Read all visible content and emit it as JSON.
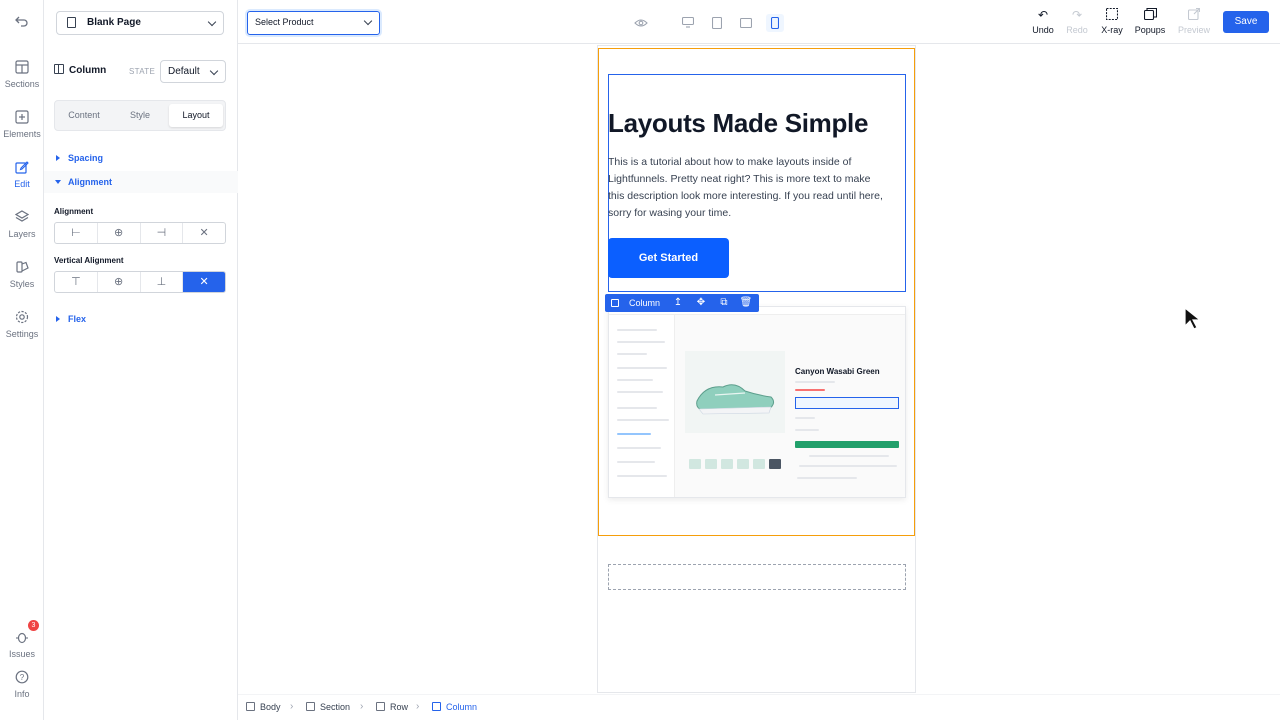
{
  "rail": {
    "back_icon": "undo-arrow-icon",
    "items": [
      {
        "label": "Sections",
        "icon": "sections-icon"
      },
      {
        "label": "Elements",
        "icon": "plus-square-icon"
      },
      {
        "label": "Edit",
        "icon": "pencil-icon"
      },
      {
        "label": "Layers",
        "icon": "layers-icon"
      },
      {
        "label": "Styles",
        "icon": "palette-icon"
      },
      {
        "label": "Settings",
        "icon": "gear-icon"
      }
    ],
    "issues": {
      "label": "Issues",
      "count": "3"
    },
    "info": {
      "label": "Info"
    }
  },
  "panel": {
    "page_select": "Blank Page",
    "element_title": "Column",
    "state_label": "STATE",
    "state_value": "Default",
    "tabs": [
      "Content",
      "Style",
      "Layout"
    ],
    "active_tab": "Layout",
    "sections": {
      "spacing": "Spacing",
      "alignment": "Alignment",
      "flex": "Flex"
    },
    "alignment_label": "Alignment",
    "vertical_alignment_label": "Vertical Alignment",
    "align_buttons": [
      "⊢",
      "⊕",
      "⊣",
      "✕"
    ],
    "valign_buttons": [
      "⊤",
      "⊕",
      "⊥",
      "✕"
    ]
  },
  "topbar": {
    "product_select": "Select Product",
    "actions": {
      "undo": "Undo",
      "redo": "Redo",
      "xray": "X-ray",
      "popups": "Popups",
      "preview": "Preview"
    },
    "save": "Save"
  },
  "canvas": {
    "hero_title": "Layouts Made Simple",
    "hero_desc": "This is a tutorial about how to make layouts inside of Lightfunnels. Pretty neat right? This is more text to make this description look more interesting. If you read until here, sorry for wasing your time.",
    "cta_label": "Get Started",
    "column_toolbar_label": "Column",
    "screenshot_product_title": "Canyon Wasabi Green"
  },
  "breadcrumbs": [
    "Body",
    "Section",
    "Row",
    "Column"
  ],
  "colors": {
    "accent": "#2563eb",
    "section_outline": "#f59e0b",
    "cta": "#0b5fff",
    "badge": "#ef4444"
  }
}
